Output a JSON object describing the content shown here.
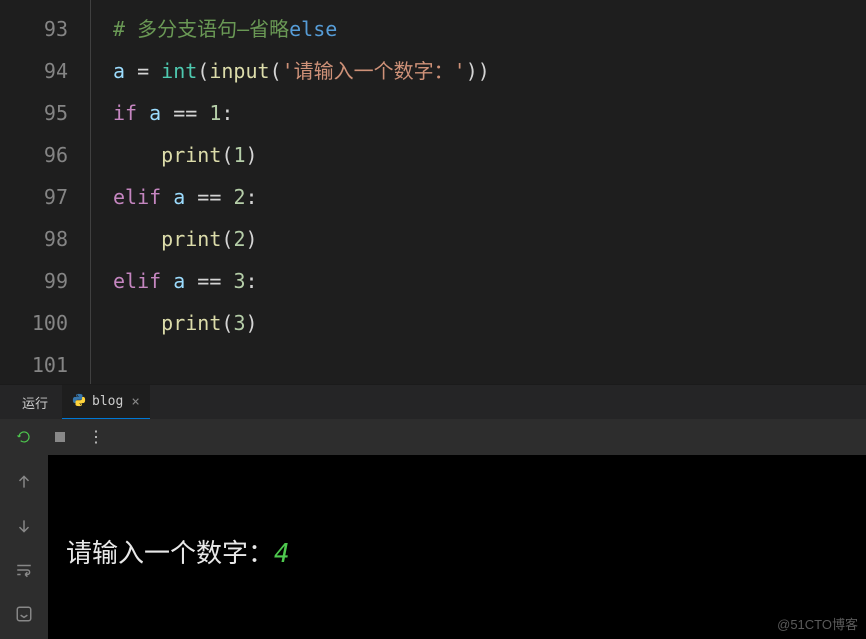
{
  "editor": {
    "line_start": 93,
    "lines": [
      {
        "n": 93,
        "tokens": [
          {
            "t": "comment",
            "v": "# 多分支语句—省略"
          },
          {
            "t": "keyword-else",
            "v": "else"
          }
        ]
      },
      {
        "n": 94,
        "tokens": [
          {
            "t": "var",
            "v": "a"
          },
          {
            "t": "op",
            "v": " = "
          },
          {
            "t": "builtin",
            "v": "int"
          },
          {
            "t": "paren",
            "v": "("
          },
          {
            "t": "func",
            "v": "input"
          },
          {
            "t": "paren",
            "v": "("
          },
          {
            "t": "string",
            "v": "'请输入一个数字：'"
          },
          {
            "t": "paren",
            "v": "))"
          }
        ]
      },
      {
        "n": 95,
        "tokens": [
          {
            "t": "keyword",
            "v": "if"
          },
          {
            "t": "op",
            "v": " "
          },
          {
            "t": "var",
            "v": "a"
          },
          {
            "t": "op",
            "v": " == "
          },
          {
            "t": "number",
            "v": "1"
          },
          {
            "t": "op",
            "v": ":"
          }
        ]
      },
      {
        "n": 96,
        "tokens": [
          {
            "t": "op",
            "v": "    "
          },
          {
            "t": "func",
            "v": "print"
          },
          {
            "t": "paren",
            "v": "("
          },
          {
            "t": "number",
            "v": "1"
          },
          {
            "t": "paren",
            "v": ")"
          }
        ]
      },
      {
        "n": 97,
        "tokens": [
          {
            "t": "keyword",
            "v": "elif"
          },
          {
            "t": "op",
            "v": " "
          },
          {
            "t": "var",
            "v": "a"
          },
          {
            "t": "op",
            "v": " == "
          },
          {
            "t": "number",
            "v": "2"
          },
          {
            "t": "op",
            "v": ":"
          }
        ]
      },
      {
        "n": 98,
        "tokens": [
          {
            "t": "op",
            "v": "    "
          },
          {
            "t": "func",
            "v": "print"
          },
          {
            "t": "paren",
            "v": "("
          },
          {
            "t": "number",
            "v": "2"
          },
          {
            "t": "paren",
            "v": ")"
          }
        ]
      },
      {
        "n": 99,
        "tokens": [
          {
            "t": "keyword",
            "v": "elif"
          },
          {
            "t": "op",
            "v": " "
          },
          {
            "t": "var",
            "v": "a"
          },
          {
            "t": "op",
            "v": " == "
          },
          {
            "t": "number",
            "v": "3"
          },
          {
            "t": "op",
            "v": ":"
          }
        ]
      },
      {
        "n": 100,
        "tokens": [
          {
            "t": "op",
            "v": "    "
          },
          {
            "t": "func",
            "v": "print"
          },
          {
            "t": "paren",
            "v": "("
          },
          {
            "t": "number",
            "v": "3"
          },
          {
            "t": "paren",
            "v": ")"
          }
        ]
      },
      {
        "n": 101,
        "tokens": []
      }
    ]
  },
  "panel": {
    "run_label": "运行",
    "tab_label": "blog",
    "tab_close": "×"
  },
  "terminal": {
    "prompt": "请输入一个数字：",
    "input_value": "4"
  },
  "watermark": "@51CTO博客"
}
